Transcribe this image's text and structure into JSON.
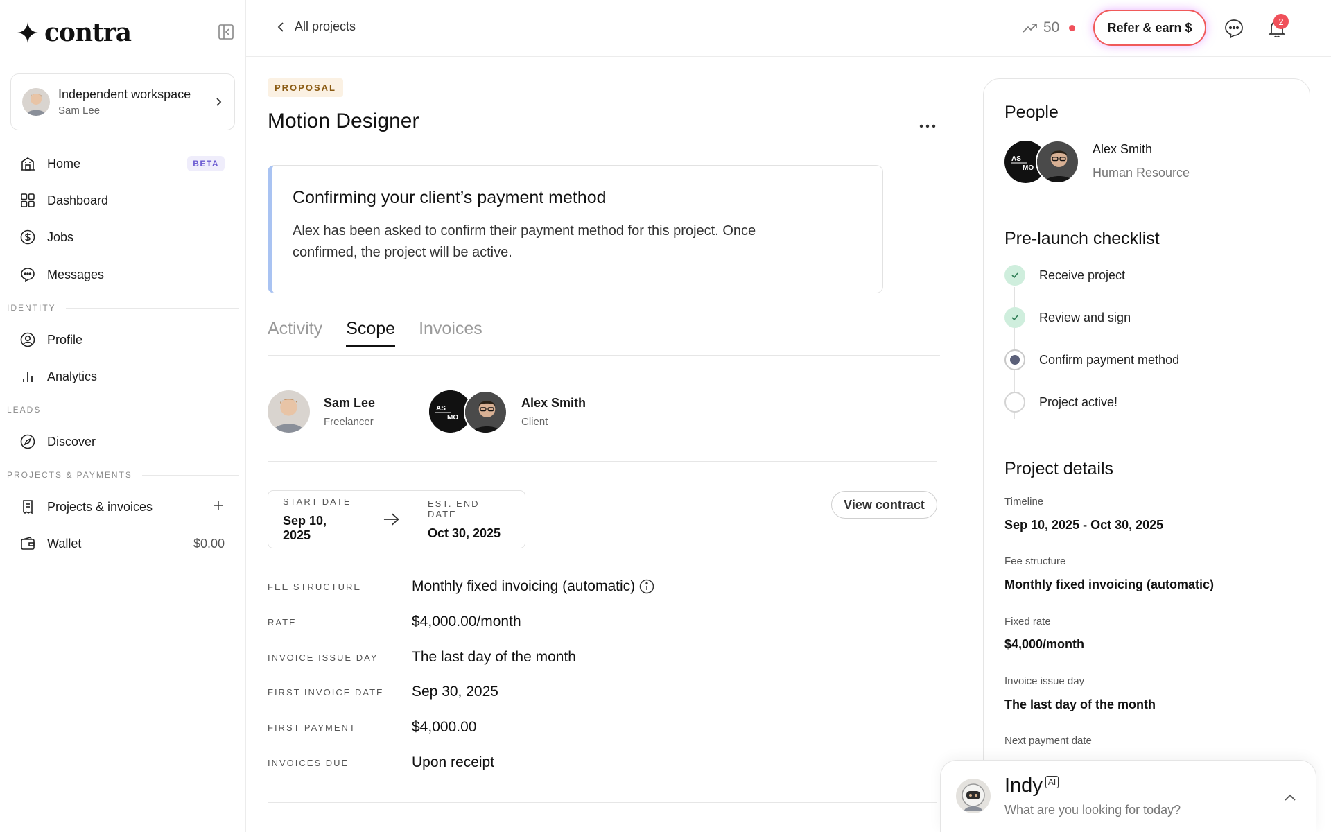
{
  "brand": {
    "name": "contra"
  },
  "workspace": {
    "title": "Independent workspace",
    "user": "Sam Lee"
  },
  "nav": {
    "home": {
      "label": "Home",
      "badge": "BETA"
    },
    "dashboard": {
      "label": "Dashboard"
    },
    "jobs": {
      "label": "Jobs"
    },
    "messages": {
      "label": "Messages"
    },
    "identity_label": "IDENTITY",
    "profile": {
      "label": "Profile"
    },
    "analytics": {
      "label": "Analytics"
    },
    "leads_label": "LEADS",
    "discover": {
      "label": "Discover"
    },
    "projects_label": "PROJECTS & PAYMENTS",
    "projects": {
      "label": "Projects & invoices"
    },
    "wallet": {
      "label": "Wallet",
      "balance": "$0.00"
    }
  },
  "topbar": {
    "back_label": "All projects",
    "streak": "50",
    "refer_label": "Refer & earn $",
    "notification_count": "2"
  },
  "project": {
    "tag": "PROPOSAL",
    "title": "Motion Designer",
    "notice": {
      "title": "Confirming your client’s payment method",
      "body": "Alex has been asked to confirm their payment method for this project. Once confirmed, the project will be active."
    },
    "tabs": [
      "Activity",
      "Scope",
      "Invoices"
    ],
    "active_tab": "Scope",
    "freelancer": {
      "name": "Sam Lee",
      "role": "Freelancer"
    },
    "client": {
      "name": "Alex Smith",
      "role": "Client",
      "logo_text": "AS MO"
    },
    "start_label": "START DATE",
    "start_date": "Sep 10, 2025",
    "end_label": "EST. END DATE",
    "end_date": "Oct 30, 2025",
    "view_contract": "View contract",
    "terms": [
      {
        "label": "FEE STRUCTURE",
        "value": "Monthly fixed invoicing (automatic)"
      },
      {
        "label": "RATE",
        "value": "$4,000.00/month"
      },
      {
        "label": "INVOICE ISSUE DAY",
        "value": "The last day of the month"
      },
      {
        "label": "FIRST INVOICE DATE",
        "value": "Sep 30, 2025"
      },
      {
        "label": "FIRST PAYMENT",
        "value": "$4,000.00"
      },
      {
        "label": "INVOICES DUE",
        "value": "Upon receipt"
      }
    ]
  },
  "panel": {
    "people_title": "People",
    "person": {
      "name": "Alex Smith",
      "role": "Human Resource"
    },
    "checklist_title": "Pre-launch checklist",
    "checklist": [
      {
        "label": "Receive project",
        "status": "done"
      },
      {
        "label": "Review and sign",
        "status": "done"
      },
      {
        "label": "Confirm payment method",
        "status": "current"
      },
      {
        "label": "Project active!",
        "status": "pending"
      }
    ],
    "details_title": "Project details",
    "details": [
      {
        "label": "Timeline",
        "value": "Sep 10, 2025 - Oct 30, 2025"
      },
      {
        "label": "Fee structure",
        "value": "Monthly fixed invoicing (automatic)"
      },
      {
        "label": "Fixed rate",
        "value": "$4,000/month"
      },
      {
        "label": "Invoice issue day",
        "value": "The last day of the month"
      },
      {
        "label": "Next payment date",
        "value": ""
      }
    ]
  },
  "indy": {
    "title": "Indy",
    "badge": "AI",
    "placeholder": "What are you looking for today?"
  },
  "colors": {
    "accent": "#6b5bd2",
    "alert": "#f0505a",
    "success": "#cfeedd",
    "notice_border": "#a9c3f2"
  },
  "icons": [
    "contra-star-logo",
    "sidebar-collapse-icon",
    "chevron-right-icon",
    "home-icon",
    "dashboard-icon",
    "dollar-icon",
    "chat-icon",
    "profile-icon",
    "analytics-icon",
    "compass-icon",
    "invoice-icon",
    "plus-icon",
    "wallet-icon",
    "back-chevron-icon",
    "trend-up-icon",
    "message-icon",
    "bell-icon",
    "more-icon",
    "arrow-right-icon",
    "info-icon",
    "check-icon",
    "chevron-up-icon"
  ]
}
